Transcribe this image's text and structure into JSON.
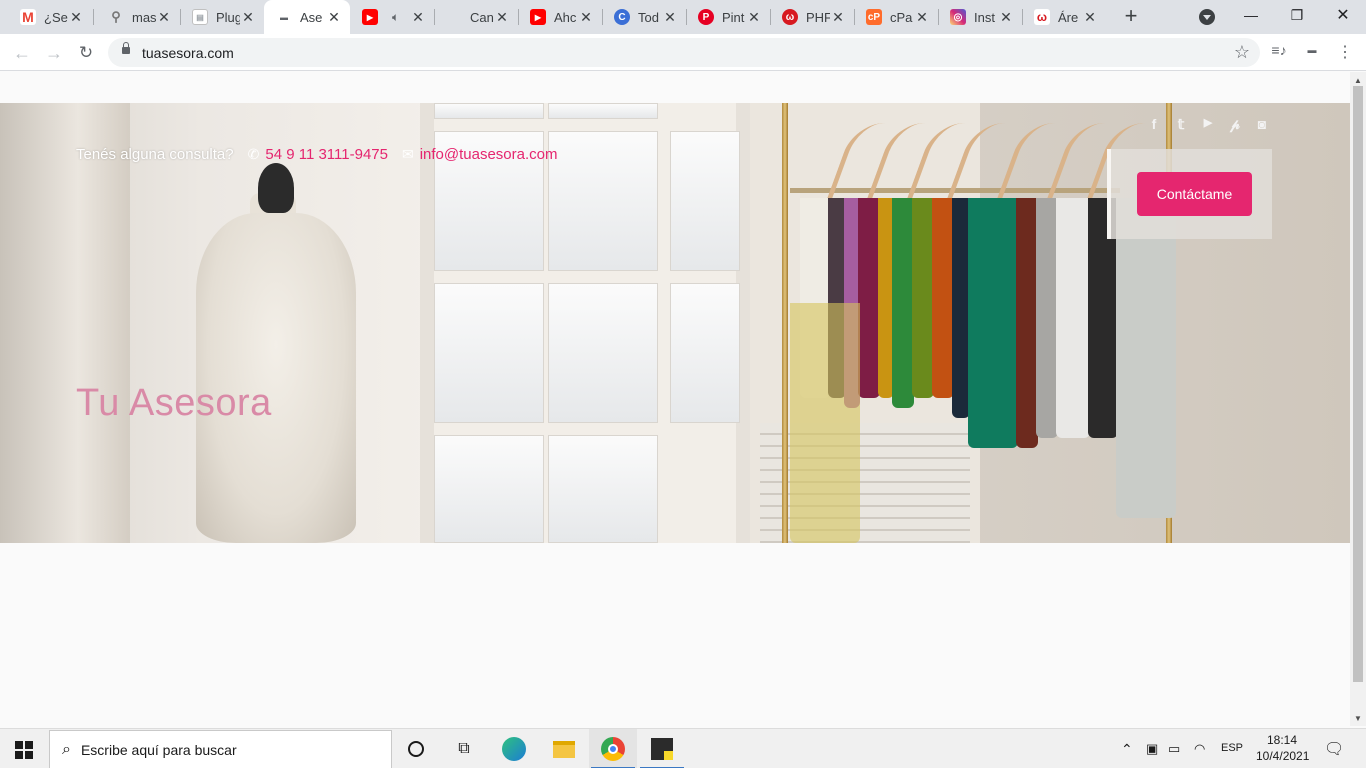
{
  "browser": {
    "tabs": [
      {
        "title": "¿Se",
        "favicon": "gmail-icon",
        "color": "#ea4335"
      },
      {
        "title": "mas",
        "favicon": "plugin-icon",
        "color": "#777777"
      },
      {
        "title": "Plug",
        "favicon": "page-icon",
        "color": "#9aa0a6"
      },
      {
        "title": "Ase",
        "favicon": "page-icon",
        "color": "#9aa0a6"
      },
      {
        "title": "",
        "favicon": "youtube-icon",
        "color": "#ff0000"
      },
      {
        "title": "Can",
        "favicon": "canva-icon",
        "color": "#00c4cc"
      },
      {
        "title": "Ahc",
        "favicon": "youtube-icon",
        "color": "#ff0000"
      },
      {
        "title": "Tod",
        "favicon": "circle-c-icon",
        "color": "#3b6fd6"
      },
      {
        "title": "Pint",
        "favicon": "pinterest-icon",
        "color": "#e60023"
      },
      {
        "title": "PHF",
        "favicon": "webhost-icon",
        "color": "#d71920"
      },
      {
        "title": "cPa",
        "favicon": "cpanel-icon",
        "color": "#ff6c2c"
      },
      {
        "title": "Inst",
        "favicon": "instagram-icon",
        "color": "#d62976"
      },
      {
        "title": "Áre",
        "favicon": "webhost-icon",
        "color": "#d71920"
      }
    ],
    "active_tab_index": 3,
    "new_tab": "+",
    "window": {
      "minimize": "—",
      "maximize": "❐",
      "close": "✕"
    },
    "url": "tuasesora.com"
  },
  "page": {
    "contact_prompt": "Tenés alguna consulta?",
    "phone": "54 9 11 3111-9475",
    "email": "info@tuasesora.com",
    "social": [
      "facebook-icon",
      "twitter-icon",
      "youtube-icon",
      "pinterest-icon",
      "instagram-icon"
    ],
    "cta_label": "Contáctame",
    "site_title": "Tu Asesora",
    "colors": {
      "accent": "#e5266f",
      "title": "#d98aa7"
    }
  },
  "taskbar": {
    "search_placeholder": "Escribe aquí para buscar",
    "language": "ESP",
    "time": "18:14",
    "date": "10/4/2021"
  }
}
